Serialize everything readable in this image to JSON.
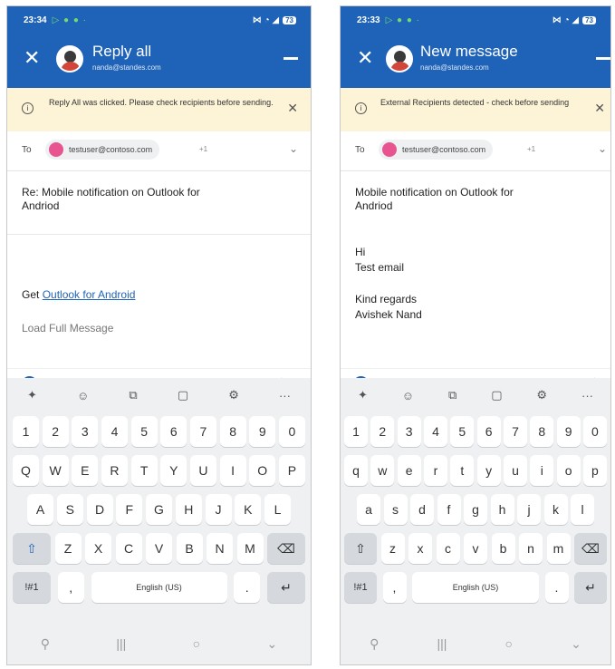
{
  "left": {
    "status": {
      "time": "23:34",
      "battery": "73"
    },
    "header": {
      "title": "Reply all",
      "subtitle": "nanda@standes.com"
    },
    "banner": "Reply All was clicked. Please check recipients before sending.",
    "to": {
      "label": "To",
      "recipient": "testuser@contoso.com",
      "more": "+1"
    },
    "subject_line1": "Re: Mobile notification on Outlook for",
    "subject_line2": "Andriod",
    "body": {
      "get_prefix": "Get ",
      "link": "Outlook for Android",
      "load": "Load Full Message"
    },
    "keyboard": {
      "numbers": [
        "1",
        "2",
        "3",
        "4",
        "5",
        "6",
        "7",
        "8",
        "9",
        "0"
      ],
      "row1": [
        "Q",
        "W",
        "E",
        "R",
        "T",
        "Y",
        "U",
        "I",
        "O",
        "P"
      ],
      "row2": [
        "A",
        "S",
        "D",
        "F",
        "G",
        "H",
        "J",
        "K",
        "L"
      ],
      "row3": [
        "Z",
        "X",
        "C",
        "V",
        "B",
        "N",
        "M"
      ],
      "sym": "!#1",
      "comma": ",",
      "space": "English (US)",
      "period": "."
    }
  },
  "right": {
    "status": {
      "time": "23:33",
      "battery": "73"
    },
    "header": {
      "title": "New message",
      "subtitle": "nanda@standes.com"
    },
    "banner": "External Recipients detected - check before sending",
    "to": {
      "label": "To",
      "recipient": "testuser@contoso.com",
      "more": "+1"
    },
    "subject_line1": "Mobile notification on Outlook for",
    "subject_line2": "Andriod",
    "body": {
      "greeting": "Hi",
      "text": "Test email",
      "sign1": "Kind regards",
      "sign2": "Avishek Nand"
    },
    "keyboard": {
      "numbers": [
        "1",
        "2",
        "3",
        "4",
        "5",
        "6",
        "7",
        "8",
        "9",
        "0"
      ],
      "row1": [
        "q",
        "w",
        "e",
        "r",
        "t",
        "y",
        "u",
        "i",
        "o",
        "p"
      ],
      "row2": [
        "a",
        "s",
        "d",
        "f",
        "g",
        "h",
        "j",
        "k",
        "l"
      ],
      "row3": [
        "z",
        "x",
        "c",
        "v",
        "b",
        "n",
        "m"
      ],
      "sym": "!#1",
      "comma": ",",
      "space": "English (US)",
      "period": "."
    }
  },
  "icons": {
    "close": "✕",
    "info": "i",
    "dismiss": "✕",
    "chevron": "⌄",
    "plus": "+",
    "attach": "⌇",
    "camera": "◎",
    "pen": "✎",
    "calendar": "▭",
    "format": "A",
    "send": "➤",
    "sparkle": "✦",
    "emoji": "☺",
    "clipboard": "⧉",
    "sticker": "▢",
    "settings": "⚙",
    "more": "···",
    "shift": "⇧",
    "backspace": "⌫",
    "enter": "↵",
    "mic": "🎙",
    "recent": "|||",
    "home": "○",
    "back": "⌄"
  }
}
